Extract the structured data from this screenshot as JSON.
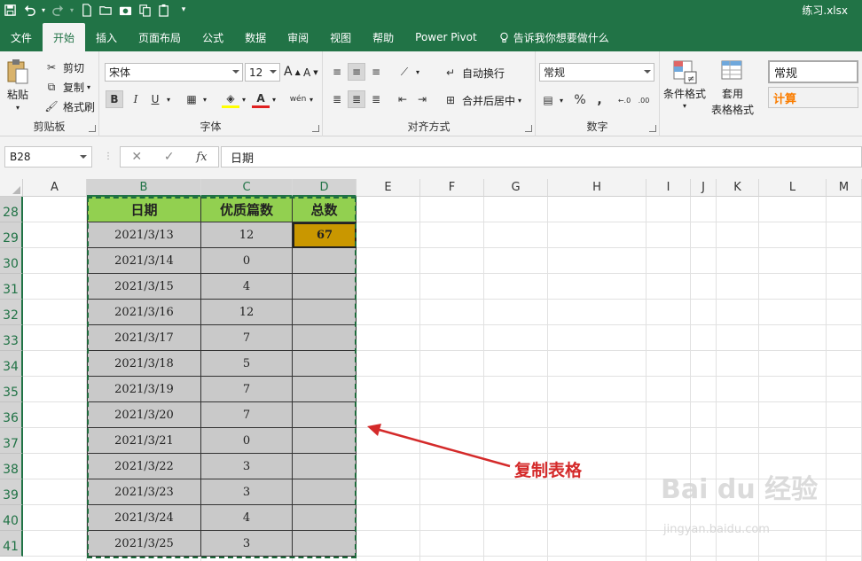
{
  "titlebar": {
    "filename": "练习.xlsx"
  },
  "tabs": [
    {
      "label": "文件",
      "active": false
    },
    {
      "label": "开始",
      "active": true
    },
    {
      "label": "插入",
      "active": false
    },
    {
      "label": "页面布局",
      "active": false
    },
    {
      "label": "公式",
      "active": false
    },
    {
      "label": "数据",
      "active": false
    },
    {
      "label": "审阅",
      "active": false
    },
    {
      "label": "视图",
      "active": false
    },
    {
      "label": "帮助",
      "active": false
    },
    {
      "label": "Power Pivot",
      "active": false
    }
  ],
  "tellme": "告诉我你想要做什么",
  "ribbon": {
    "clipboard": {
      "paste": "粘贴",
      "cut": "剪切",
      "copy": "复制",
      "format_painter": "格式刷",
      "label": "剪贴板"
    },
    "font": {
      "family": "宋体",
      "size": "12",
      "bold": "B",
      "italic": "I",
      "underline": "U",
      "label": "字体",
      "grow": "A",
      "shrink": "A",
      "wen": "wén"
    },
    "alignment": {
      "wrap": "自动换行",
      "merge": "合并后居中",
      "label": "对齐方式"
    },
    "number": {
      "format": "常规",
      "percent": "%",
      "comma": ",",
      "label": "数字"
    },
    "styles": {
      "conditional": "条件格式",
      "table_line1": "套用",
      "table_line2": "表格格式",
      "style_normal": "常规",
      "style_calc": "计算"
    }
  },
  "formula_bar": {
    "name_box": "B28",
    "formula": "日期"
  },
  "columns": [
    {
      "label": "A",
      "selected": false
    },
    {
      "label": "B",
      "selected": true
    },
    {
      "label": "C",
      "selected": true
    },
    {
      "label": "D",
      "selected": true
    },
    {
      "label": "E",
      "selected": false
    },
    {
      "label": "F",
      "selected": false
    },
    {
      "label": "G",
      "selected": false
    },
    {
      "label": "H",
      "selected": false
    },
    {
      "label": "I",
      "selected": false
    },
    {
      "label": "J",
      "selected": false
    },
    {
      "label": "K",
      "selected": false
    },
    {
      "label": "L",
      "selected": false
    },
    {
      "label": "M",
      "selected": false
    }
  ],
  "rows": [
    "28",
    "29",
    "30",
    "31",
    "32",
    "33",
    "34",
    "35",
    "36",
    "37",
    "38",
    "39",
    "40",
    "41"
  ],
  "table": {
    "headers": [
      "日期",
      "优质篇数",
      "总数"
    ],
    "total": "67",
    "records": [
      {
        "date": "2021/3/13",
        "count": "12"
      },
      {
        "date": "2021/3/14",
        "count": "0"
      },
      {
        "date": "2021/3/15",
        "count": "4"
      },
      {
        "date": "2021/3/16",
        "count": "12"
      },
      {
        "date": "2021/3/17",
        "count": "7"
      },
      {
        "date": "2021/3/18",
        "count": "5"
      },
      {
        "date": "2021/3/19",
        "count": "7"
      },
      {
        "date": "2021/3/20",
        "count": "7"
      },
      {
        "date": "2021/3/21",
        "count": "0"
      },
      {
        "date": "2021/3/22",
        "count": "3"
      },
      {
        "date": "2021/3/23",
        "count": "3"
      },
      {
        "date": "2021/3/24",
        "count": "4"
      },
      {
        "date": "2021/3/25",
        "count": "3"
      }
    ]
  },
  "annotation": "复制表格",
  "watermark": {
    "main": "Bai du 经验",
    "sub": "jingyan.baidu.com"
  },
  "colors": {
    "excel_green": "#217346",
    "header_green": "#92d050",
    "data_gray": "#c9c9c9",
    "total_gold": "#c99700",
    "annotation_red": "#d42a2a"
  }
}
